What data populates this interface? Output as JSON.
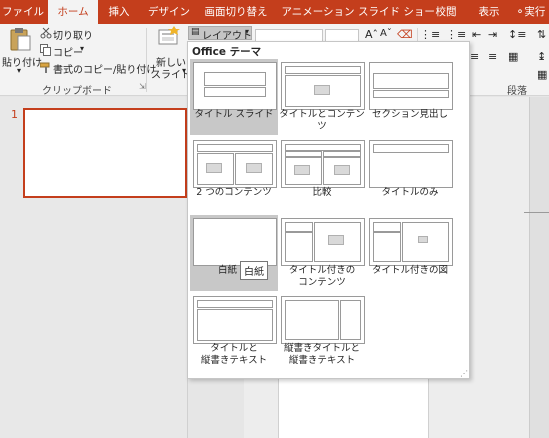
{
  "tabs": [
    "ファイル",
    "ホーム",
    "挿入",
    "デザイン",
    "画面切り替え",
    "アニメーション",
    "スライド ショー",
    "校閲",
    "表示"
  ],
  "tell_me": "実行",
  "clipboard": {
    "paste_label": "貼り付け",
    "cut_label": "切り取り",
    "copy_label": "コピー",
    "format_painter_label": "書式のコピー/貼り付け",
    "group_label": "クリップボード"
  },
  "slides": {
    "new_slide_label": "新しい",
    "new_slide_label2": "スライド",
    "layout_button_label": "レイアウト"
  },
  "paragraph_group_label": "段落",
  "gallery": {
    "title": "Office テーマ",
    "items": [
      {
        "label": "タイトル スライド"
      },
      {
        "label": "タイトルとコンテンツ"
      },
      {
        "label": "セクション見出し"
      },
      {
        "label": "2 つのコンテンツ"
      },
      {
        "label": "比較"
      },
      {
        "label": "タイトルのみ"
      },
      {
        "label": "白紙"
      },
      {
        "label": "タイトル付きの"
      },
      {
        "label": "タイトル付きの図"
      },
      {
        "label": "タイトルと"
      },
      {
        "label": "縦書きタイトルと"
      }
    ],
    "item_line2": {
      "twocontent": "コンテンツ",
      "vert1": "縦書きテキスト",
      "vert2": "縦書きテキスト"
    },
    "tooltip": "白紙"
  },
  "slide_number": "1",
  "accent_color": "#c43e1c"
}
